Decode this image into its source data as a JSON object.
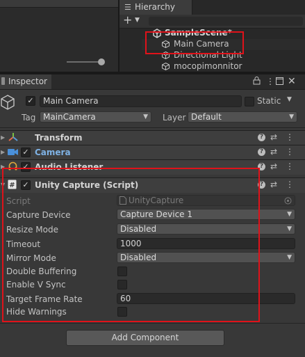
{
  "hierarchy": {
    "tab_label": "Hierarchy",
    "tab_icon": "list-icon",
    "scene_name": "SampleScene*",
    "items": [
      {
        "label": "Main Camera",
        "icon": "cube-icon"
      },
      {
        "label": "Directional Light",
        "icon": "cube-icon"
      },
      {
        "label": "mocopimonnitor",
        "icon": "cube-icon"
      }
    ]
  },
  "inspector": {
    "tab_label": "Inspector",
    "object": {
      "name": "Main Camera",
      "static_label": "Static",
      "tag_label": "Tag",
      "tag_value": "MainCamera",
      "layer_label": "Layer",
      "layer_value": "Default",
      "active": true
    },
    "components": [
      {
        "name": "Transform",
        "icon": "transform-icon",
        "has_checkbox": false
      },
      {
        "name": "Camera",
        "icon": "camera-icon",
        "has_checkbox": true
      },
      {
        "name": "Audio Listener",
        "icon": "headphones-icon",
        "has_checkbox": true
      },
      {
        "name": "Unity Capture (Script)",
        "icon": "script-icon",
        "has_checkbox": true
      }
    ],
    "unity_capture": {
      "script_label": "Script",
      "script_value": "UnityCapture",
      "properties": [
        {
          "label": "Capture Device",
          "type": "dropdown",
          "value": "Capture Device 1"
        },
        {
          "label": "Resize Mode",
          "type": "dropdown",
          "value": "Disabled"
        },
        {
          "label": "Timeout",
          "type": "number",
          "value": "1000"
        },
        {
          "label": "Mirror Mode",
          "type": "dropdown",
          "value": "Disabled"
        },
        {
          "label": "Double Buffering",
          "type": "checkbox",
          "value": false
        },
        {
          "label": "Enable V Sync",
          "type": "checkbox",
          "value": false
        },
        {
          "label": "Target Frame Rate",
          "type": "number",
          "value": "60"
        },
        {
          "label": "Hide Warnings",
          "type": "checkbox",
          "value": false
        }
      ]
    },
    "add_component_label": "Add Component"
  },
  "colors": {
    "highlight": "#e0121a",
    "camera_name": "#6fa8dc"
  }
}
